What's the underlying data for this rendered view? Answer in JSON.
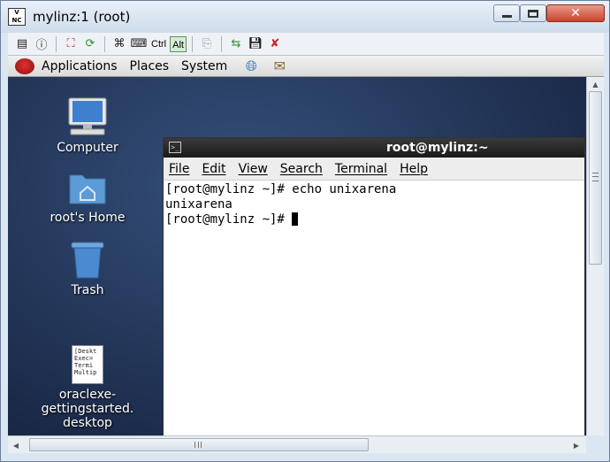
{
  "window": {
    "title": "mylinz:1 (root)",
    "close_glyph": "✕"
  },
  "vnc_toolbar": {
    "ctrl_label": "Ctrl",
    "alt_label": "Alt",
    "icons": [
      "options-icon",
      "info-icon",
      "fullscreen-icon",
      "refresh-icon",
      "send-keys-icon",
      "keyboard-icon",
      "copy-icon",
      "transfer-icon",
      "save-icon",
      "disconnect-icon"
    ]
  },
  "panel": {
    "menus": [
      "Applications",
      "Places",
      "System"
    ],
    "icons": [
      "web-browser-icon",
      "mail-icon"
    ]
  },
  "desktop": {
    "icons": [
      {
        "label": "Computer"
      },
      {
        "label": "root's Home"
      },
      {
        "label": "Trash"
      },
      {
        "label": "oraclexe-gettingstarted.desktop",
        "line1": "oraclexe-",
        "line2": "gettingstarted.",
        "line3": "desktop",
        "thumb_lines": [
          "[Deskt",
          "Exec=",
          "Termi",
          "Multip"
        ]
      }
    ]
  },
  "terminal": {
    "title": "root@mylinz:~",
    "menu": [
      "File",
      "Edit",
      "View",
      "Search",
      "Terminal",
      "Help"
    ],
    "lines": [
      "[root@mylinz ~]# echo unixarena",
      "unixarena",
      "[root@mylinz ~]# "
    ]
  },
  "colors": {
    "desktop_bg": "#1d2d4d",
    "terminal_title_bg": "#1a1a1a",
    "close_button": "#c7432c"
  }
}
